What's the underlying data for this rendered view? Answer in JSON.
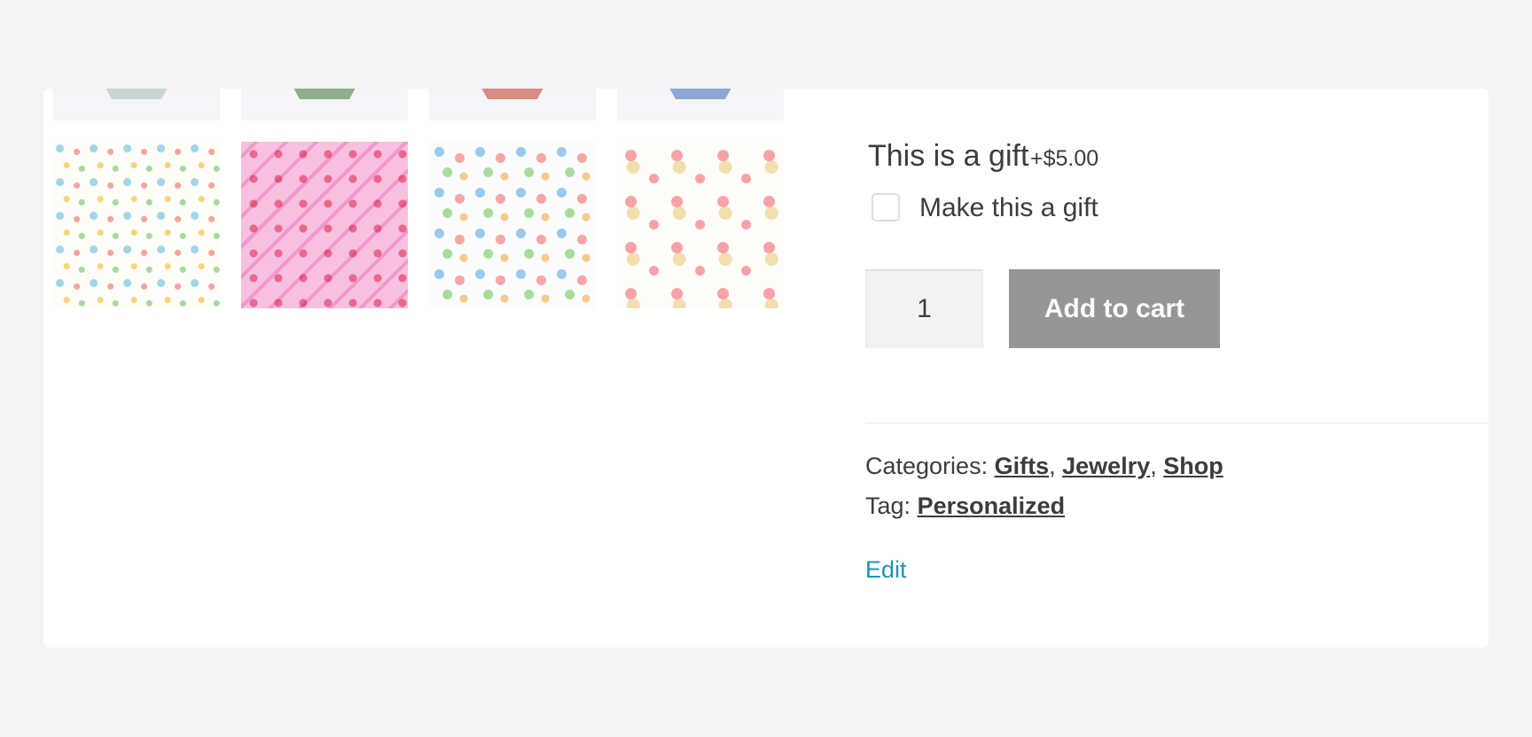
{
  "product": {
    "gift_option": {
      "title": "This is a gift",
      "price": "+$5.00",
      "checkbox_label": "Make this a gift",
      "checked": false
    },
    "quantity": "1",
    "add_to_cart_label": "Add to cart",
    "categories": {
      "label": "Categories:",
      "items": [
        "Gifts",
        "Jewelry",
        "Shop"
      ]
    },
    "tag": {
      "label": "Tag:",
      "value": "Personalized"
    },
    "edit_label": "Edit"
  },
  "gallery": {
    "box_colors": [
      "#c9d6d6",
      "#8fae8c",
      "#d88c84",
      "#8ea6d2"
    ],
    "swatches": [
      "gift-boxes-pattern",
      "pink-chevron-hearts-pattern",
      "happy-birthday-pattern",
      "bells-bows-pattern"
    ]
  },
  "colors": {
    "accent_link": "#1d94b5",
    "button_bg": "#969696"
  }
}
